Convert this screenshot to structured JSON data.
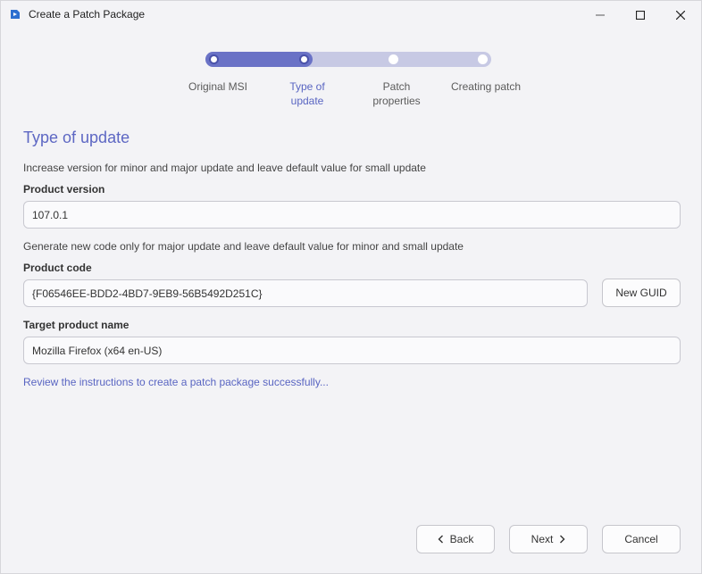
{
  "window": {
    "title": "Create a Patch Package"
  },
  "stepper": {
    "steps": [
      {
        "label_line1": "Original MSI",
        "label_line2": "",
        "state": "done"
      },
      {
        "label_line1": "Type of",
        "label_line2": "update",
        "state": "current"
      },
      {
        "label_line1": "Patch",
        "label_line2": "properties",
        "state": "pending"
      },
      {
        "label_line1": "Creating patch",
        "label_line2": "",
        "state": "pending"
      }
    ]
  },
  "main": {
    "heading": "Type of update",
    "version_hint": "Increase version for minor and major update and leave default value for small update",
    "product_version_label": "Product version",
    "product_version_value": "107.0.1",
    "code_hint": "Generate new code only for major update and leave default value for minor and small update",
    "product_code_label": "Product code",
    "product_code_value": "{F06546EE-BDD2-4BD7-9EB9-56B5492D251C}",
    "new_guid_label": "New GUID",
    "target_name_label": "Target product name",
    "target_name_value": "Mozilla Firefox (x64 en-US)",
    "instructions_link": "Review the instructions to create a patch package successfully..."
  },
  "footer": {
    "back_label": "Back",
    "next_label": "Next",
    "cancel_label": "Cancel"
  },
  "colors": {
    "accent": "#5d67c3",
    "track": "#c7c9e4",
    "track_fill": "#6a72c6"
  },
  "icons": {
    "app": "advanced-installer-icon",
    "back": "chevron-left-icon",
    "next": "chevron-right-icon"
  }
}
